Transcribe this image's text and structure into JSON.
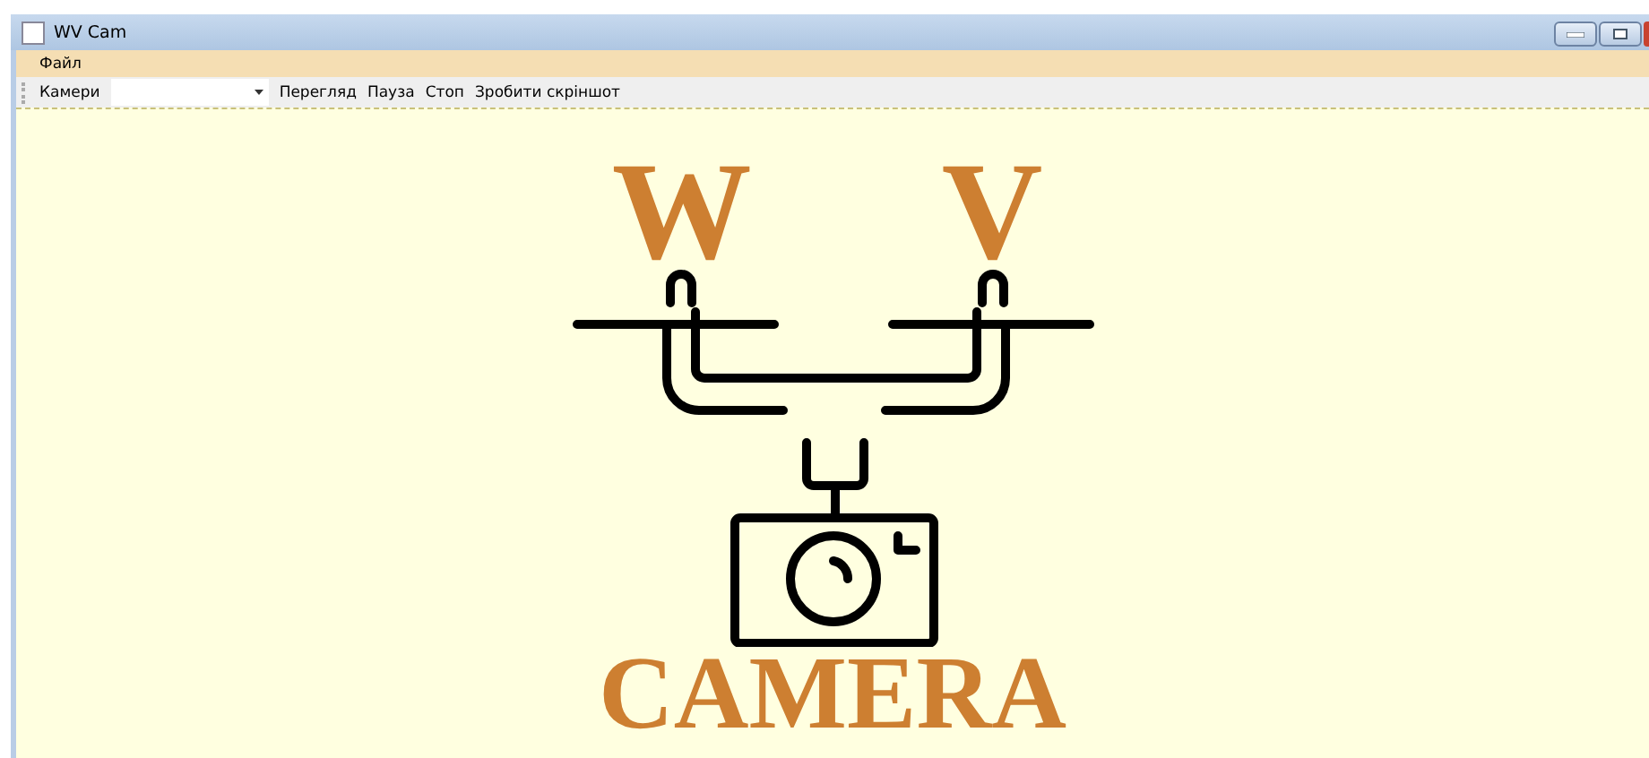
{
  "window": {
    "title": "WV Cam"
  },
  "menu": [
    "Файл"
  ],
  "toolbar": [
    {
      "kind": "label",
      "text": "Камери"
    },
    {
      "kind": "combo"
    },
    {
      "kind": "button",
      "text": "Перегляд"
    },
    {
      "kind": "button",
      "text": "Пауза"
    },
    {
      "kind": "button",
      "text": "Стоп"
    },
    {
      "kind": "button",
      "text": "Зробити скріншот"
    }
  ],
  "logo": {
    "letters": [
      "W",
      "V"
    ],
    "wordmark": "CAMERA"
  }
}
